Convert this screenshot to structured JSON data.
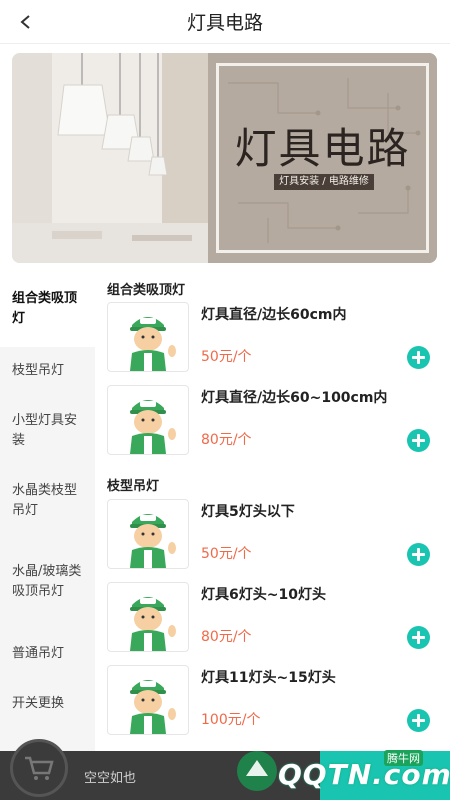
{
  "header": {
    "title": "灯具电路"
  },
  "banner": {
    "title": "灯具电路",
    "tag": "灯具安装 / 电路维修"
  },
  "sidebar": {
    "items": [
      {
        "label": "组合类吸顶灯"
      },
      {
        "label": "枝型吊灯"
      },
      {
        "label": "小型灯具安装"
      },
      {
        "label": "水晶类枝型吊灯"
      },
      {
        "label": "水晶/玻璃类吸顶吊灯"
      },
      {
        "label": "普通吊灯"
      },
      {
        "label": "开关更换"
      }
    ]
  },
  "sections": [
    {
      "title": "组合类吸顶灯",
      "items": [
        {
          "name": "灯具直径/边长60cm内",
          "price": "50元/个"
        },
        {
          "name": "灯具直径/边长60~100cm内",
          "price": "80元/个"
        }
      ]
    },
    {
      "title": "枝型吊灯",
      "items": [
        {
          "name": "灯具5灯头以下",
          "price": "50元/个"
        },
        {
          "name": "灯具6灯头~10灯头",
          "price": "80元/个"
        },
        {
          "name": "灯具11灯头~15灯头",
          "price": "100元/个"
        }
      ]
    }
  ],
  "cart": {
    "empty_text": "空空如也"
  },
  "watermark": {
    "text": "QQTN.com",
    "badge": "腾牛网"
  },
  "colors": {
    "accent": "#19c4b0",
    "price": "#f06a4a",
    "cartbar": "#3b3b3b"
  }
}
